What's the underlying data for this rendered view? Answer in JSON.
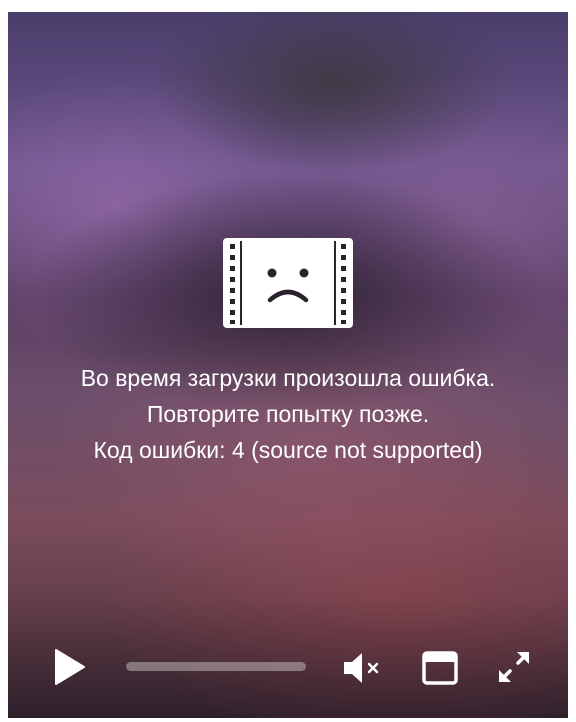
{
  "error": {
    "line1": "Во время загрузки произошла ошибка.",
    "line2": "Повторите попытку позже.",
    "line3": "Код ошибки: 4 (source not supported)"
  },
  "controls": {
    "play_icon": "play-icon",
    "mute_icon": "volume-muted-icon",
    "pip_icon": "picture-in-picture-icon",
    "fullscreen_icon": "fullscreen-icon",
    "progress": 0
  },
  "colors": {
    "text": "#ffffff",
    "icon": "#ffffff"
  }
}
